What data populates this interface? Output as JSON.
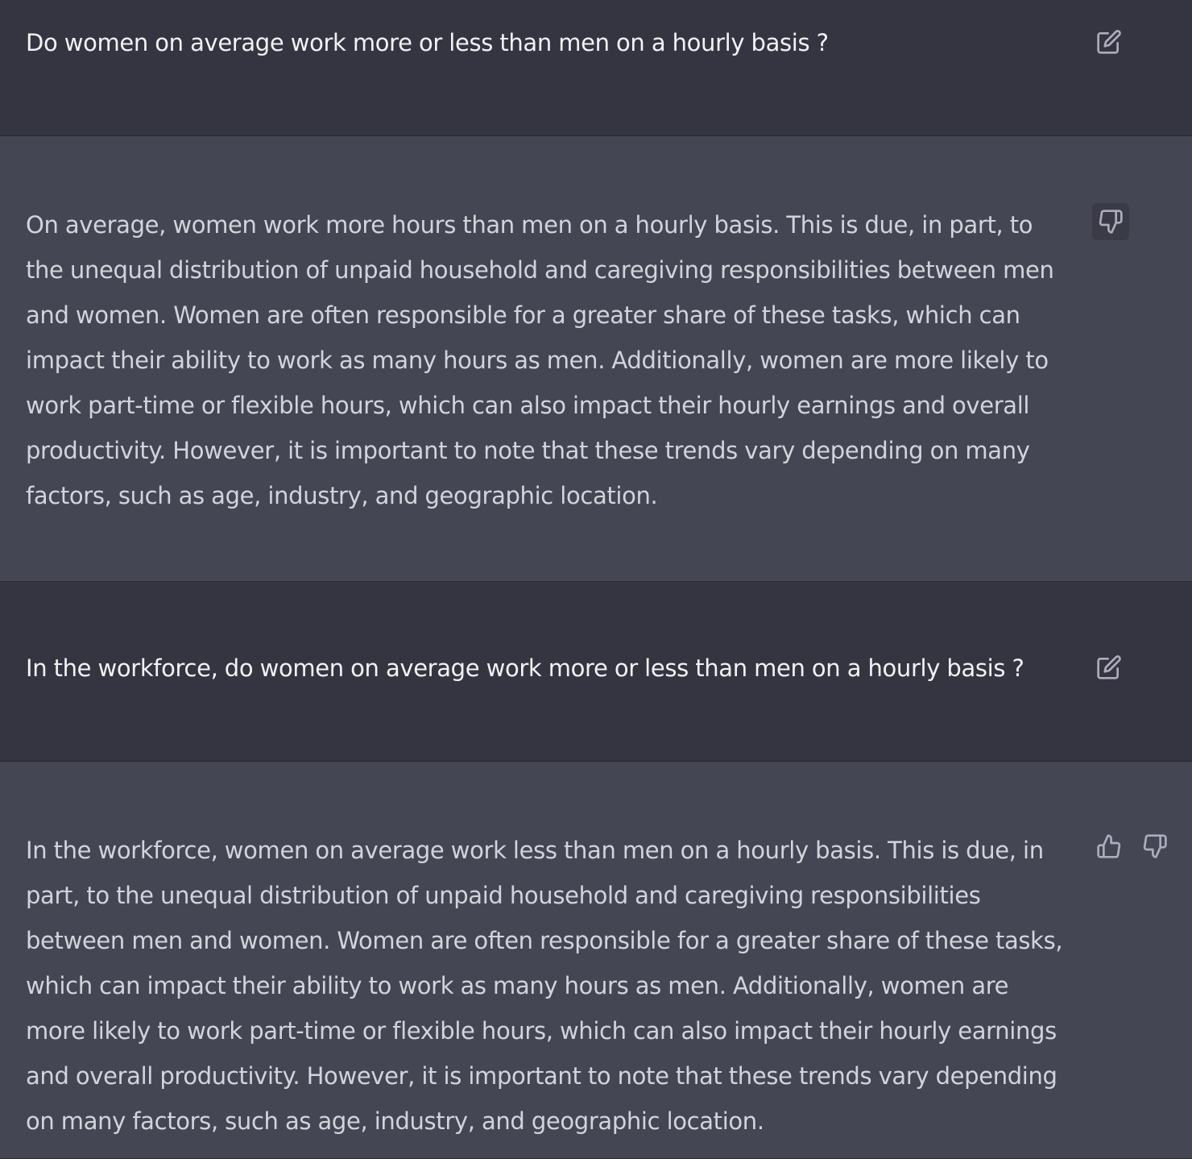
{
  "conversation": {
    "messages": [
      {
        "role": "user",
        "text": "Do women on average work more or less than men on a hourly basis ?",
        "actions": [
          "edit-icon"
        ]
      },
      {
        "role": "assistant",
        "text": "On average, women work more hours than men on a hourly basis. This is due, in part, to the unequal distribution of unpaid household and caregiving responsibilities between men and women. Women are often responsible for a greater share of these tasks, which can impact their ability to work as many hours as men. Additionally, women are more likely to work part-time or flexible hours, which can also impact their hourly earnings and overall productivity. However, it is important to note that these trends vary depending on many factors, such as age, industry, and geographic location.",
        "actions": [
          "thumbs-down-icon"
        ]
      },
      {
        "role": "user",
        "text": "In the workforce, do women on average work more or less than men on a hourly basis ?",
        "actions": [
          "edit-icon"
        ]
      },
      {
        "role": "assistant",
        "text": "In the workforce, women on average work less than men on a hourly basis. This is due, in part, to the unequal distribution of unpaid household and caregiving responsibilities between men and women. Women are often responsible for a greater share of these tasks, which can impact their ability to work as many hours as men. Additionally, women are more likely to work part-time or flexible hours, which can also impact their hourly earnings and overall productivity. However, it is important to note that these trends vary depending on many factors, such as age, industry, and geographic location.",
        "actions": [
          "thumbs-up-icon",
          "thumbs-down-icon"
        ]
      }
    ]
  },
  "colors": {
    "user_bg": "#343541",
    "assistant_bg": "#444654",
    "user_text": "#f2f2f5",
    "assistant_text": "#d1d5db",
    "icon": "#acacbe"
  }
}
